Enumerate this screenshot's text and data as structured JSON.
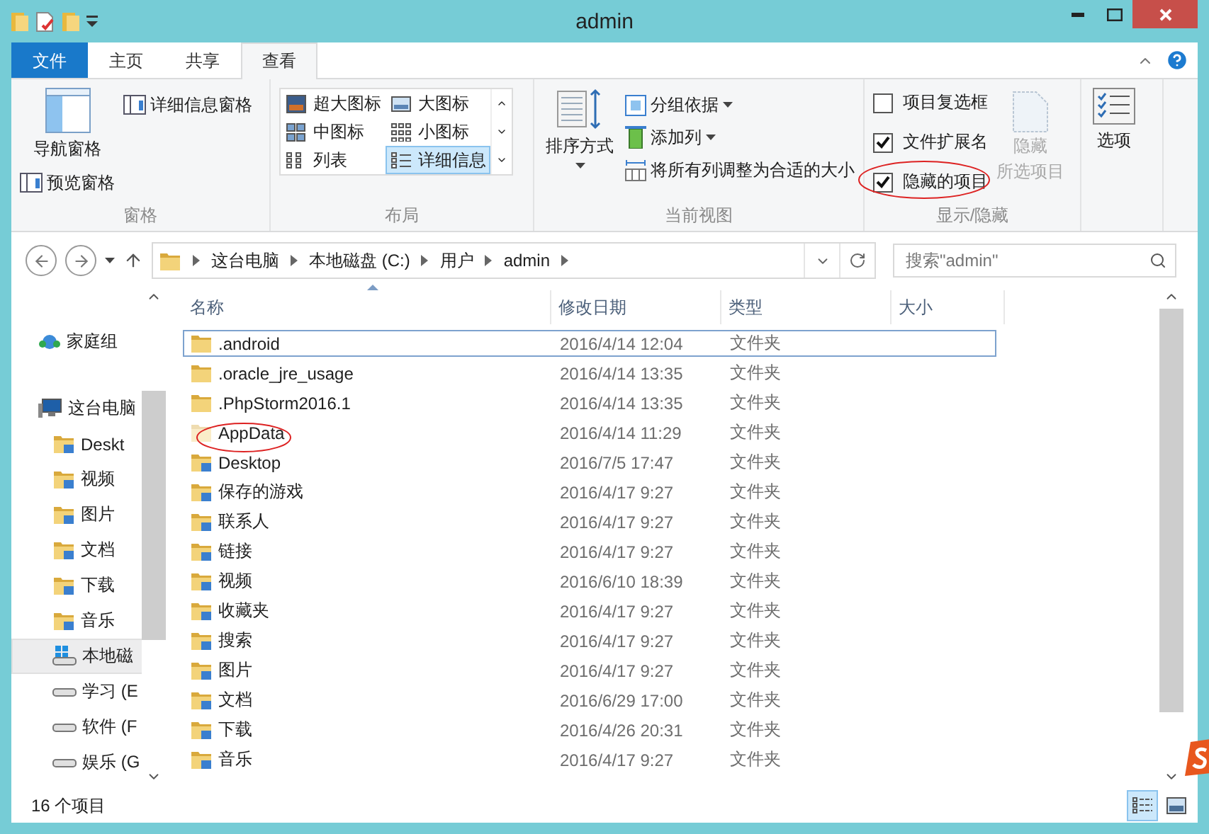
{
  "window": {
    "title": "admin"
  },
  "ribbon_tabs": [
    {
      "label": "文件",
      "kind": "file",
      "selected": false
    },
    {
      "label": "主页",
      "kind": "tab",
      "selected": false
    },
    {
      "label": "共享",
      "kind": "tab",
      "selected": false
    },
    {
      "label": "查看",
      "kind": "tab",
      "selected": true
    }
  ],
  "ribbon": {
    "panes": {
      "label": "窗格",
      "nav_pane": "导航窗格",
      "preview_pane": "预览窗格",
      "details_pane": "详细信息窗格"
    },
    "layout": {
      "label": "布局",
      "options": [
        {
          "label": "超大图标",
          "kind": "xl",
          "selected": false
        },
        {
          "label": "大图标",
          "kind": "large",
          "selected": false
        },
        {
          "label": "中图标",
          "kind": "medium",
          "selected": false
        },
        {
          "label": "小图标",
          "kind": "small",
          "selected": false
        },
        {
          "label": "列表",
          "kind": "list",
          "selected": false
        },
        {
          "label": "详细信息",
          "kind": "details",
          "selected": true
        }
      ]
    },
    "current_view": {
      "label": "当前视图",
      "sort_by": "排序方式",
      "group_by": "分组依据",
      "add_columns": "添加列",
      "size_columns": "将所有列调整为合适的大小"
    },
    "show_hide": {
      "label": "显示/隐藏",
      "checkboxes": [
        {
          "label": "项目复选框",
          "checked": false
        },
        {
          "label": "文件扩展名",
          "checked": true
        },
        {
          "label": "隐藏的项目",
          "checked": true
        }
      ],
      "hide_selected": {
        "lines": [
          "隐藏",
          "所选项目"
        ],
        "disabled": true
      }
    },
    "options": {
      "label": "选项"
    }
  },
  "address": {
    "breadcrumbs": [
      "这台电脑",
      "本地磁盘 (C:)",
      "用户",
      "admin"
    ]
  },
  "search": {
    "placeholder": "搜索\"admin\""
  },
  "nav": {
    "items": [
      {
        "label": "家庭组",
        "kind": "homegroup",
        "selected": false
      },
      {
        "label": "这台电脑",
        "kind": "computer",
        "selected": false,
        "children": [
          {
            "label": "Deskt",
            "kind": "folder",
            "selected": false
          },
          {
            "label": "视频",
            "kind": "folder",
            "selected": false
          },
          {
            "label": "图片",
            "kind": "folder",
            "selected": false
          },
          {
            "label": "文档",
            "kind": "folder",
            "selected": false
          },
          {
            "label": "下载",
            "kind": "folder",
            "selected": false
          },
          {
            "label": "音乐",
            "kind": "folder",
            "selected": false
          },
          {
            "label": "本地磁",
            "kind": "system_drive",
            "selected": true
          },
          {
            "label": "学习 (E",
            "kind": "drive",
            "selected": false
          },
          {
            "label": "软件 (F",
            "kind": "drive",
            "selected": false
          },
          {
            "label": "娱乐 (G",
            "kind": "drive",
            "selected": false
          }
        ]
      }
    ]
  },
  "table": {
    "columns": [
      {
        "label": "名称",
        "sorted": true
      },
      {
        "label": "修改日期",
        "sorted": false
      },
      {
        "label": "类型",
        "sorted": false
      },
      {
        "label": "大小",
        "sorted": false
      }
    ],
    "rows": [
      {
        "name": ".android",
        "date": "2016/4/14 12:04",
        "type": "文件夹",
        "kind": "folder",
        "focused": true
      },
      {
        "name": ".oracle_jre_usage",
        "date": "2016/4/14 13:35",
        "type": "文件夹",
        "kind": "folder",
        "focused": false
      },
      {
        "name": ".PhpStorm2016.1",
        "date": "2016/4/14 13:35",
        "type": "文件夹",
        "kind": "folder",
        "focused": false
      },
      {
        "name": "AppData",
        "date": "2016/4/14 11:29",
        "type": "文件夹",
        "kind": "hidden",
        "focused": false
      },
      {
        "name": "Desktop",
        "date": "2016/7/5 17:47",
        "type": "文件夹",
        "kind": "special",
        "focused": false
      },
      {
        "name": "保存的游戏",
        "date": "2016/4/17 9:27",
        "type": "文件夹",
        "kind": "special",
        "focused": false
      },
      {
        "name": "联系人",
        "date": "2016/4/17 9:27",
        "type": "文件夹",
        "kind": "special",
        "focused": false
      },
      {
        "name": "链接",
        "date": "2016/4/17 9:27",
        "type": "文件夹",
        "kind": "special",
        "focused": false
      },
      {
        "name": "视频",
        "date": "2016/6/10 18:39",
        "type": "文件夹",
        "kind": "special",
        "focused": false
      },
      {
        "name": "收藏夹",
        "date": "2016/4/17 9:27",
        "type": "文件夹",
        "kind": "special",
        "focused": false
      },
      {
        "name": "搜索",
        "date": "2016/4/17 9:27",
        "type": "文件夹",
        "kind": "special",
        "focused": false
      },
      {
        "name": "图片",
        "date": "2016/4/17 9:27",
        "type": "文件夹",
        "kind": "special",
        "focused": false
      },
      {
        "name": "文档",
        "date": "2016/6/29 17:00",
        "type": "文件夹",
        "kind": "special",
        "focused": false
      },
      {
        "name": "下载",
        "date": "2016/4/26 20:31",
        "type": "文件夹",
        "kind": "special",
        "focused": false
      },
      {
        "name": "音乐",
        "date": "2016/4/17 9:27",
        "type": "文件夹",
        "kind": "special",
        "focused": false
      }
    ]
  },
  "status_bar": {
    "item_count": "16 个项目",
    "views": [
      {
        "kind": "details",
        "selected": true
      },
      {
        "kind": "large_icons",
        "selected": false
      }
    ]
  }
}
